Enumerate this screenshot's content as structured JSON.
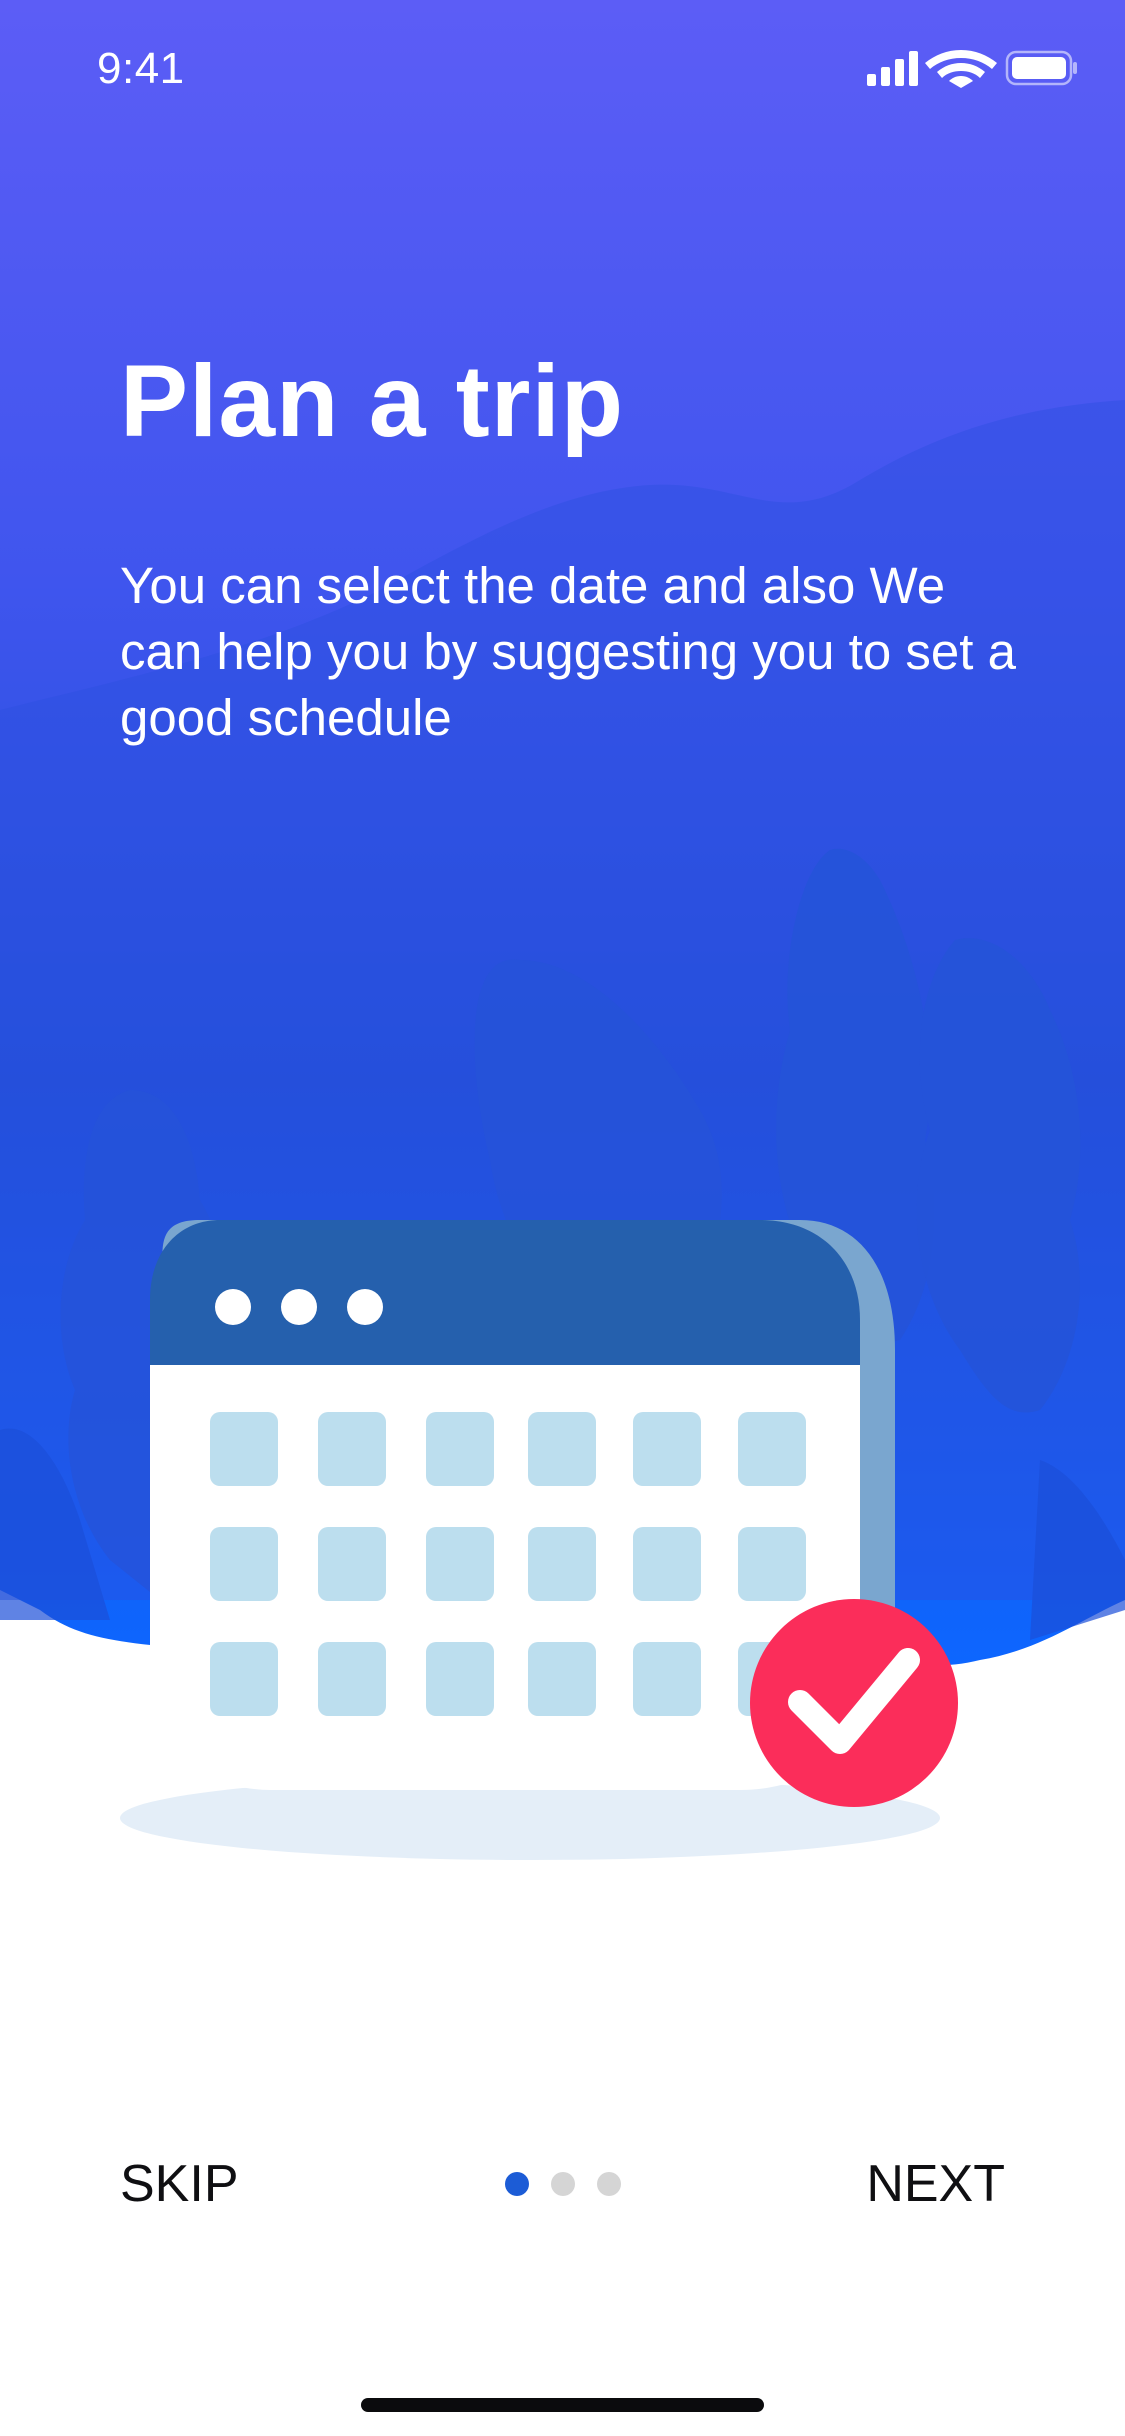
{
  "status_bar": {
    "time": "9:41"
  },
  "onboarding": {
    "title": "Plan a trip",
    "description": "You can select the date and also We can help you by suggesting you to set a good schedule"
  },
  "illustration": {
    "icon": "calendar-check-icon"
  },
  "footer": {
    "skip_label": "SKIP",
    "next_label": "NEXT",
    "pages_total": 3,
    "current_page": 1
  },
  "colors": {
    "gradient_top": "#5b5cf5",
    "gradient_bottom": "#0f63ff",
    "calendar_header": "#2560ad",
    "calendar_cell": "#bcdeee",
    "check_badge": "#fb2d5a",
    "dot_active": "#1c5cd6",
    "dot_inactive": "#d5d5d5"
  }
}
